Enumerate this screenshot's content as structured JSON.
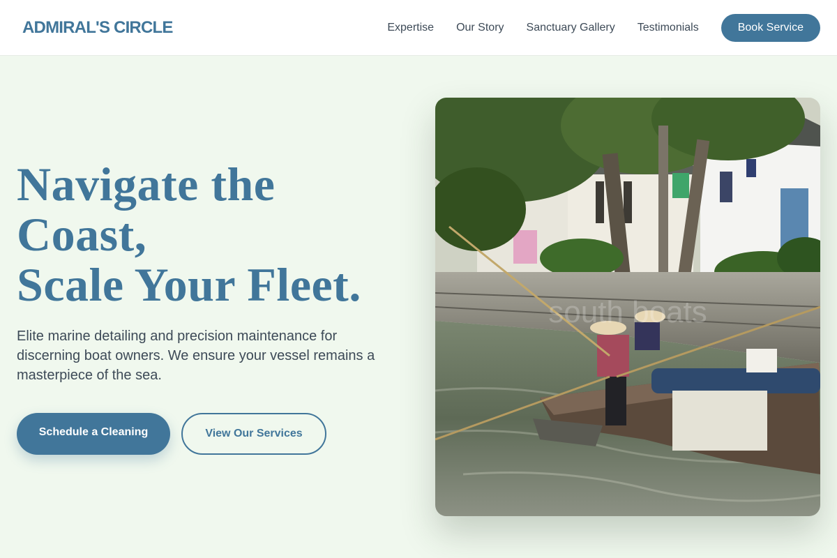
{
  "header": {
    "logo": "ADMIRAL'S CIRCLE",
    "nav": [
      "Expertise",
      "Our Story",
      "Sanctuary Gallery",
      "Testimonials"
    ],
    "cta": "Book Service"
  },
  "hero": {
    "headline_lines": [
      "Navigate the",
      "Coast,",
      "Scale Your Fleet."
    ],
    "subtext": "Elite marine detailing and precision maintenance for discerning boat owners. We ensure your vessel remains a masterpiece of the sea.",
    "primary_button": "Schedule a Cleaning",
    "secondary_button": "View Our Services",
    "image_alt": "south boats",
    "image_watermark": "south boats"
  },
  "colors": {
    "accent": "#41769a",
    "background": "#f0f8ee",
    "header_bg": "#ffffff",
    "body_text": "#3d4a57"
  }
}
